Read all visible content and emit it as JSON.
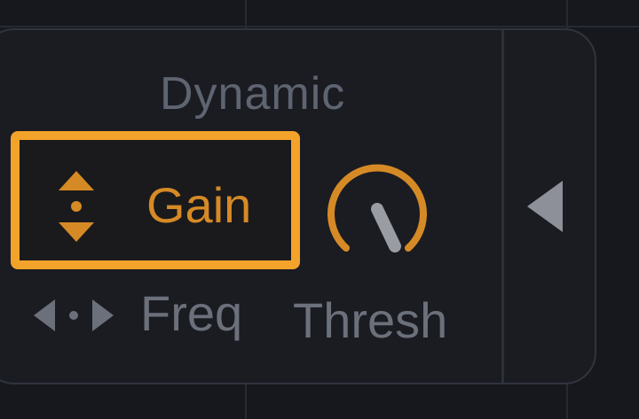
{
  "panel": {
    "section_title": "Dynamic",
    "gain_mode_label": "Gain",
    "freq_mode_label": "Freq",
    "thresh_label": "Thresh"
  },
  "colors": {
    "background": "#16181e",
    "panel_background": "#1a1c22",
    "panel_border": "#30343d",
    "accent": "#f3a32a",
    "accent_text": "#d68a26",
    "muted_text": "#6b707b",
    "title_text": "#5e6470",
    "knob_indicator": "#9a9ca3"
  },
  "icons": {
    "gain": "vertical-drag-arrows-icon",
    "freq": "horizontal-drag-arrows-icon",
    "collapse": "triangle-left-icon"
  }
}
